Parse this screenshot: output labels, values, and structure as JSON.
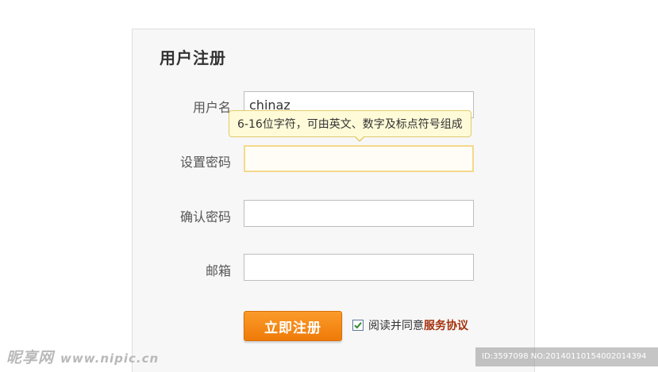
{
  "form": {
    "title": "用户注册",
    "fields": {
      "username": {
        "label": "用户名",
        "value": "chinaz"
      },
      "password": {
        "label": "设置密码",
        "value": ""
      },
      "confirm_password": {
        "label": "确认密码",
        "value": ""
      },
      "email": {
        "label": "邮箱",
        "value": ""
      }
    },
    "tooltip": "6-16位字符，可由英文、数字及标点符号组成",
    "submit_label": "立即注册",
    "agreement": {
      "checked": true,
      "text": "阅读并同意",
      "link_text": "服务协议"
    }
  },
  "watermark": {
    "brand": "昵享网",
    "url": "www.nipic.cn",
    "id_text": "ID:3597098 NO:20140110154002014394"
  },
  "colors": {
    "button": "#f08208",
    "link": "#a5300b",
    "tooltip_bg": "#fffbd8",
    "focus_border": "#f5d98a"
  }
}
